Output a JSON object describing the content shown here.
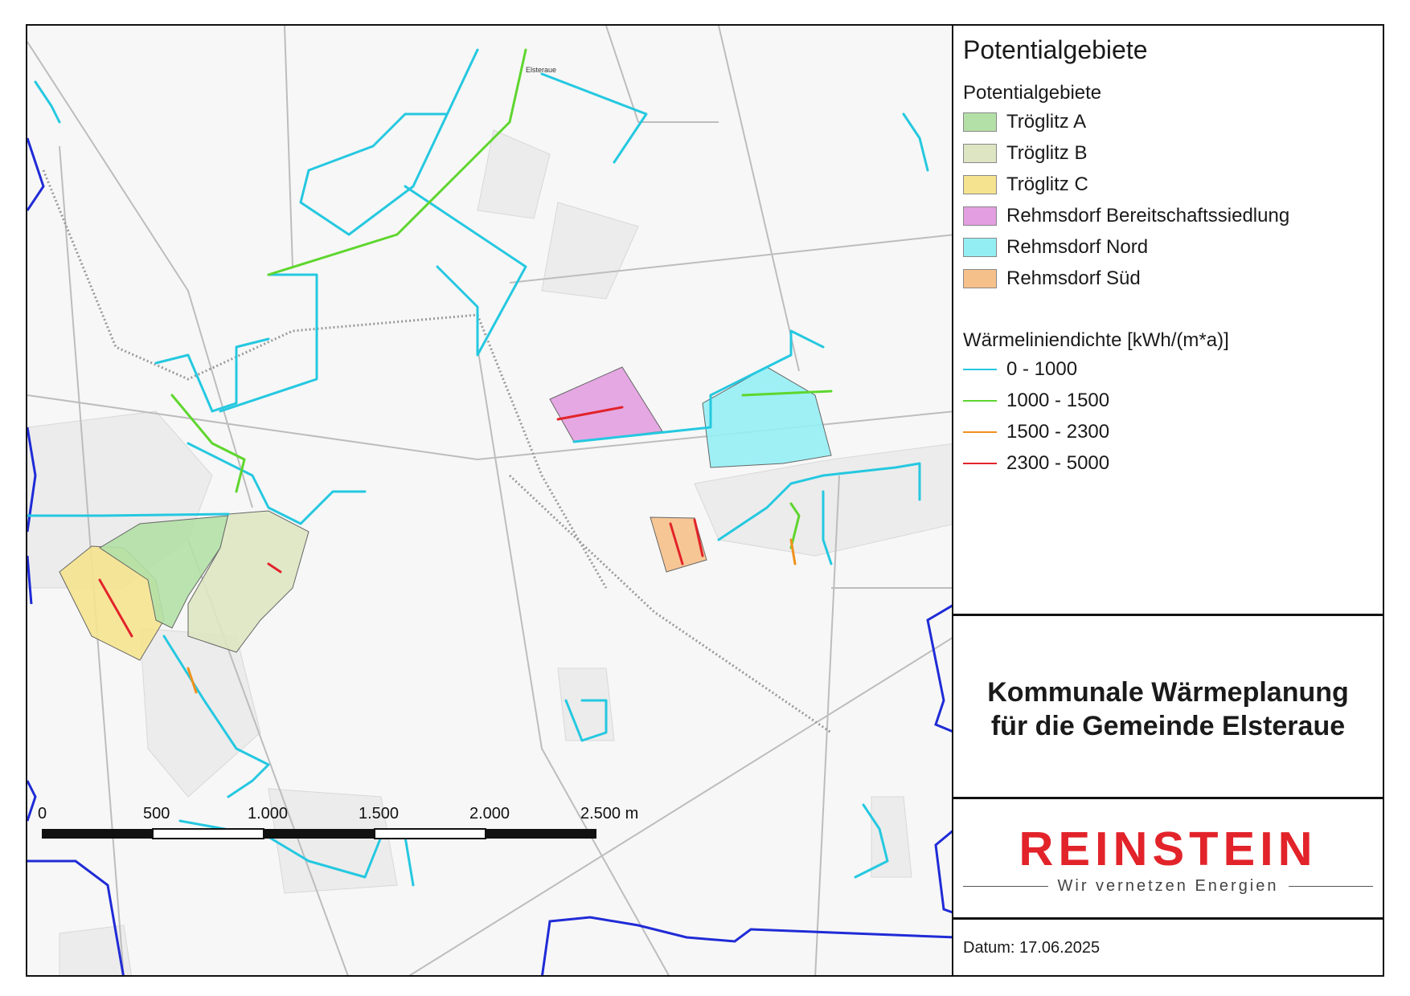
{
  "legend": {
    "title": "Potentialgebiete",
    "areas_heading": "Potentialgebiete",
    "areas": [
      {
        "label": "Tröglitz A",
        "color": "#b3e0a6"
      },
      {
        "label": "Tröglitz B",
        "color": "#dde5c2"
      },
      {
        "label": "Tröglitz C",
        "color": "#f5e38f"
      },
      {
        "label": "Rehmsdorf Bereitschaftssiedlung",
        "color": "#e29ee0"
      },
      {
        "label": "Rehmsdorf Nord",
        "color": "#93eef4"
      },
      {
        "label": "Rehmsdorf Süd",
        "color": "#f6c08a"
      }
    ],
    "lines_heading": "Wärmeliniendichte [kWh/(m*a)]",
    "lines": [
      {
        "label": "0 - 1000",
        "color": "#25c8e0"
      },
      {
        "label": "1000 - 1500",
        "color": "#5ed62e"
      },
      {
        "label": "1500 - 2300",
        "color": "#f0911d"
      },
      {
        "label": "2300 - 5000",
        "color": "#e2232a"
      }
    ]
  },
  "title": {
    "line1": "Kommunale Wärmeplanung",
    "line2": "für die Gemeinde Elsteraue"
  },
  "logo": {
    "name": "REINSTEIN",
    "tagline": "Wir vernetzen Energien",
    "color": "#e2232a"
  },
  "date": "Datum: 17.06.2025",
  "scale_bar": {
    "labels": [
      "0",
      "500",
      "1.000",
      "1.500",
      "2.000",
      "2.500 m"
    ]
  },
  "map": {
    "boundary_color": "#1f2bd6",
    "place_label": "Elsteraue"
  }
}
